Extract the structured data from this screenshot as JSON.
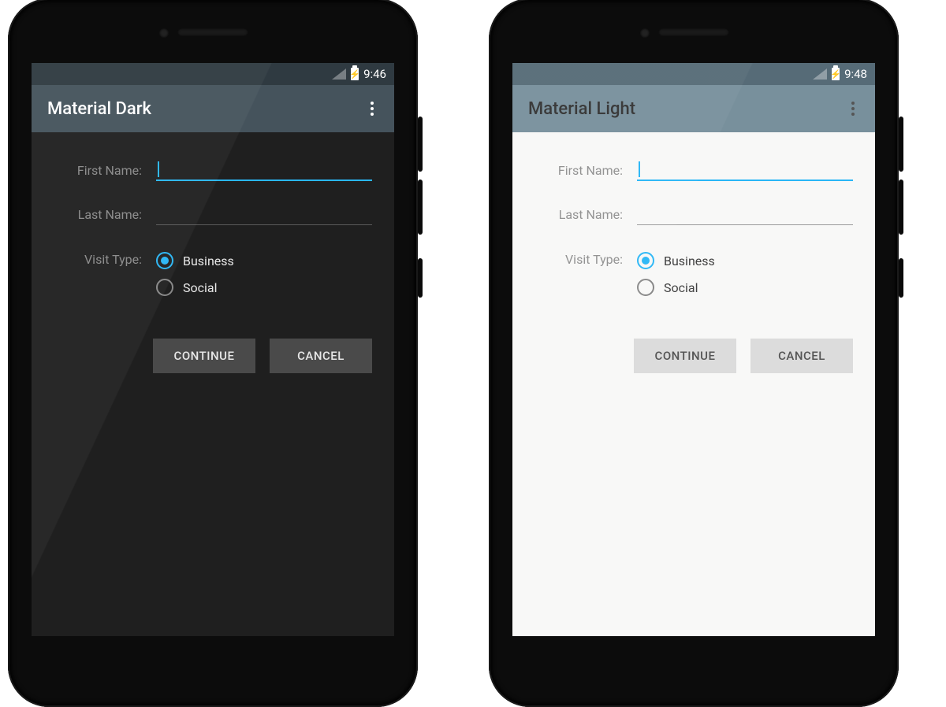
{
  "dark": {
    "status": {
      "time": "9:46"
    },
    "appbar": {
      "title": "Material Dark"
    },
    "form": {
      "first_name": {
        "label": "First Name:",
        "value": ""
      },
      "last_name": {
        "label": "Last Name:",
        "value": ""
      },
      "visit_type": {
        "label": "Visit Type:",
        "options": [
          "Business",
          "Social"
        ],
        "selected": "Business"
      }
    },
    "buttons": {
      "continue": "CONTINUE",
      "cancel": "CANCEL"
    }
  },
  "light": {
    "status": {
      "time": "9:48"
    },
    "appbar": {
      "title": "Material Light"
    },
    "form": {
      "first_name": {
        "label": "First Name:",
        "value": ""
      },
      "last_name": {
        "label": "Last Name:",
        "value": ""
      },
      "visit_type": {
        "label": "Visit Type:",
        "options": [
          "Business",
          "Social"
        ],
        "selected": "Business"
      }
    },
    "buttons": {
      "continue": "CONTINUE",
      "cancel": "CANCEL"
    }
  },
  "colors": {
    "accent": "#29b6f6"
  }
}
